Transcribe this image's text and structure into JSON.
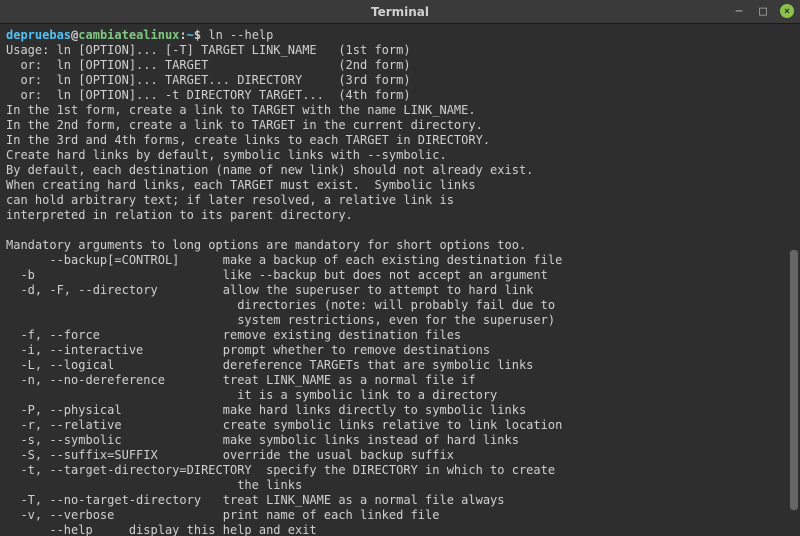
{
  "titlebar": {
    "title": "Terminal"
  },
  "prompt": {
    "user": "depruebas",
    "at": "@",
    "host": "cambiatealinux",
    "colon": ":",
    "path": "~",
    "dollar": "$",
    "command": "ln --help"
  },
  "output": {
    "l1": "Usage: ln [OPTION]... [-T] TARGET LINK_NAME   (1st form)",
    "l2": "  or:  ln [OPTION]... TARGET                  (2nd form)",
    "l3": "  or:  ln [OPTION]... TARGET... DIRECTORY     (3rd form)",
    "l4": "  or:  ln [OPTION]... -t DIRECTORY TARGET...  (4th form)",
    "l5": "In the 1st form, create a link to TARGET with the name LINK_NAME.",
    "l6": "In the 2nd form, create a link to TARGET in the current directory.",
    "l7": "In the 3rd and 4th forms, create links to each TARGET in DIRECTORY.",
    "l8": "Create hard links by default, symbolic links with --symbolic.",
    "l9": "By default, each destination (name of new link) should not already exist.",
    "l10": "When creating hard links, each TARGET must exist.  Symbolic links",
    "l11": "can hold arbitrary text; if later resolved, a relative link is",
    "l12": "interpreted in relation to its parent directory.",
    "l13": "",
    "l14": "Mandatory arguments to long options are mandatory for short options too.",
    "l15": "      --backup[=CONTROL]      make a backup of each existing destination file",
    "l16": "  -b                          like --backup but does not accept an argument",
    "l17": "  -d, -F, --directory         allow the superuser to attempt to hard link",
    "l18": "                                directories (note: will probably fail due to",
    "l19": "                                system restrictions, even for the superuser)",
    "l20": "  -f, --force                 remove existing destination files",
    "l21": "  -i, --interactive           prompt whether to remove destinations",
    "l22": "  -L, --logical               dereference TARGETs that are symbolic links",
    "l23": "  -n, --no-dereference        treat LINK_NAME as a normal file if",
    "l24": "                                it is a symbolic link to a directory",
    "l25": "  -P, --physical              make hard links directly to symbolic links",
    "l26": "  -r, --relative              create symbolic links relative to link location",
    "l27": "  -s, --symbolic              make symbolic links instead of hard links",
    "l28": "  -S, --suffix=SUFFIX         override the usual backup suffix",
    "l29": "  -t, --target-directory=DIRECTORY  specify the DIRECTORY in which to create",
    "l30": "                                the links",
    "l31": "  -T, --no-target-directory   treat LINK_NAME as a normal file always",
    "l32": "  -v, --verbose               print name of each linked file",
    "l33": "      --help     display this help and exit"
  }
}
